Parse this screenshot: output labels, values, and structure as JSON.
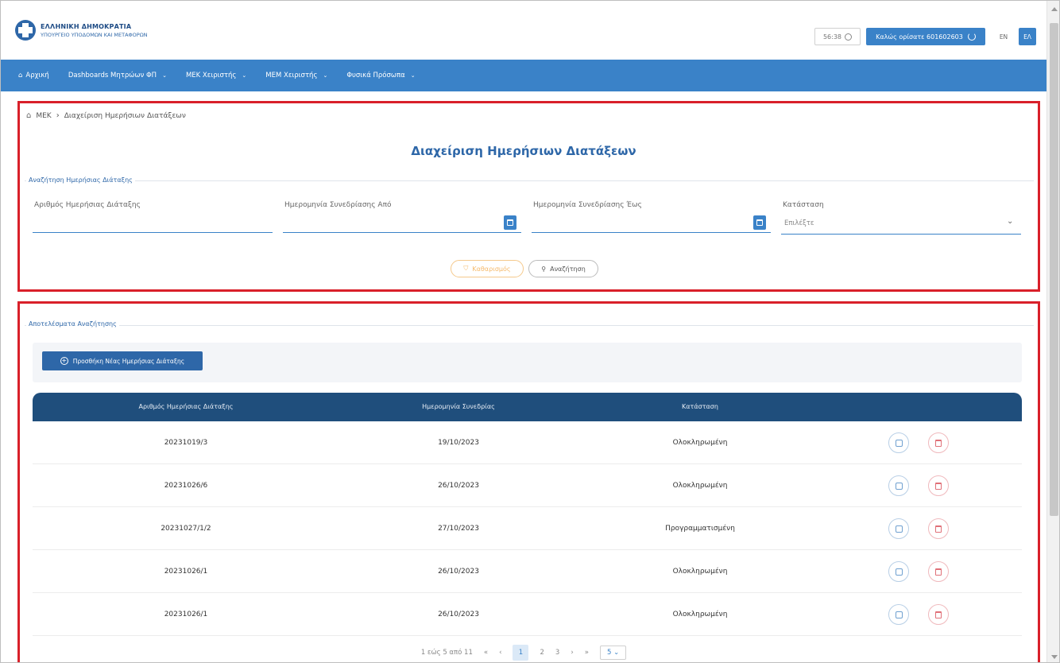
{
  "header": {
    "logo_line1": "ΕΛΛΗΝΙΚΗ ΔΗΜΟΚΡΑΤΙΑ",
    "logo_line2": "ΥΠΟΥΡΓΕΙΟ ΥΠΟΔΟΜΩΝ ΚΑΙ ΜΕΤΑΦΟΡΩΝ",
    "timer": "56:38",
    "welcome": "Καλώς ορίσατε 601602603",
    "lang_en": "EN",
    "lang_el": "ΕΛ"
  },
  "nav": {
    "home": "Αρχική",
    "item1": "Dashboards Μητρώων ΦΠ",
    "item2": "ΜΕΚ Χειριστής",
    "item3": "ΜΕΜ Χειριστής",
    "item4": "Φυσικά Πρόσωπα"
  },
  "breadcrumb": {
    "root": "ΜΕΚ",
    "current": "Διαχείριση Ημερήσιων Διατάξεων"
  },
  "page_title": "Διαχείριση Ημερήσιων Διατάξεων",
  "search": {
    "legend": "Αναζήτηση Ημερήσιας Διάταξης",
    "label_number": "Αριθμός Ημερήσιας Διάταξης",
    "label_date_from": "Ημερομηνία Συνεδρίασης Από",
    "label_date_to": "Ημερομηνία Συνεδρίασης Έως",
    "label_status": "Κατάσταση",
    "status_value": "Επιλέξτε",
    "clear_label": "Καθαρισμός",
    "search_label": "Αναζήτηση"
  },
  "results": {
    "legend": "Αποτελέσματα Αναζήτησης",
    "add_label": "Προσθήκη Νέας Ημερήσιας Διάταξης",
    "columns": [
      "Αριθμός Ημερήσιας Διάταξης",
      "Ημερομηνία Συνεδρίας",
      "Κατάσταση"
    ],
    "rows": [
      {
        "number": "20231019/3",
        "date": "19/10/2023",
        "status": "Ολοκληρωμένη"
      },
      {
        "number": "20231026/6",
        "date": "26/10/2023",
        "status": "Ολοκληρωμένη"
      },
      {
        "number": "20231027/1/2",
        "date": "27/10/2023",
        "status": "Προγραμματισμένη"
      },
      {
        "number": "20231026/1",
        "date": "26/10/2023",
        "status": "Ολοκληρωμένη"
      },
      {
        "number": "20231026/1",
        "date": "26/10/2023",
        "status": "Ολοκληρωμένη"
      }
    ]
  },
  "pager": {
    "summary": "1 εώς 5 από 11",
    "first": "«",
    "prev": "‹",
    "p1": "1",
    "p2": "2",
    "p3": "3",
    "next": "›",
    "last": "»",
    "page_size": "5"
  },
  "colors": {
    "primary": "#3a82c8",
    "table_header": "#1f4e7c",
    "highlight_border": "#d9202a"
  }
}
